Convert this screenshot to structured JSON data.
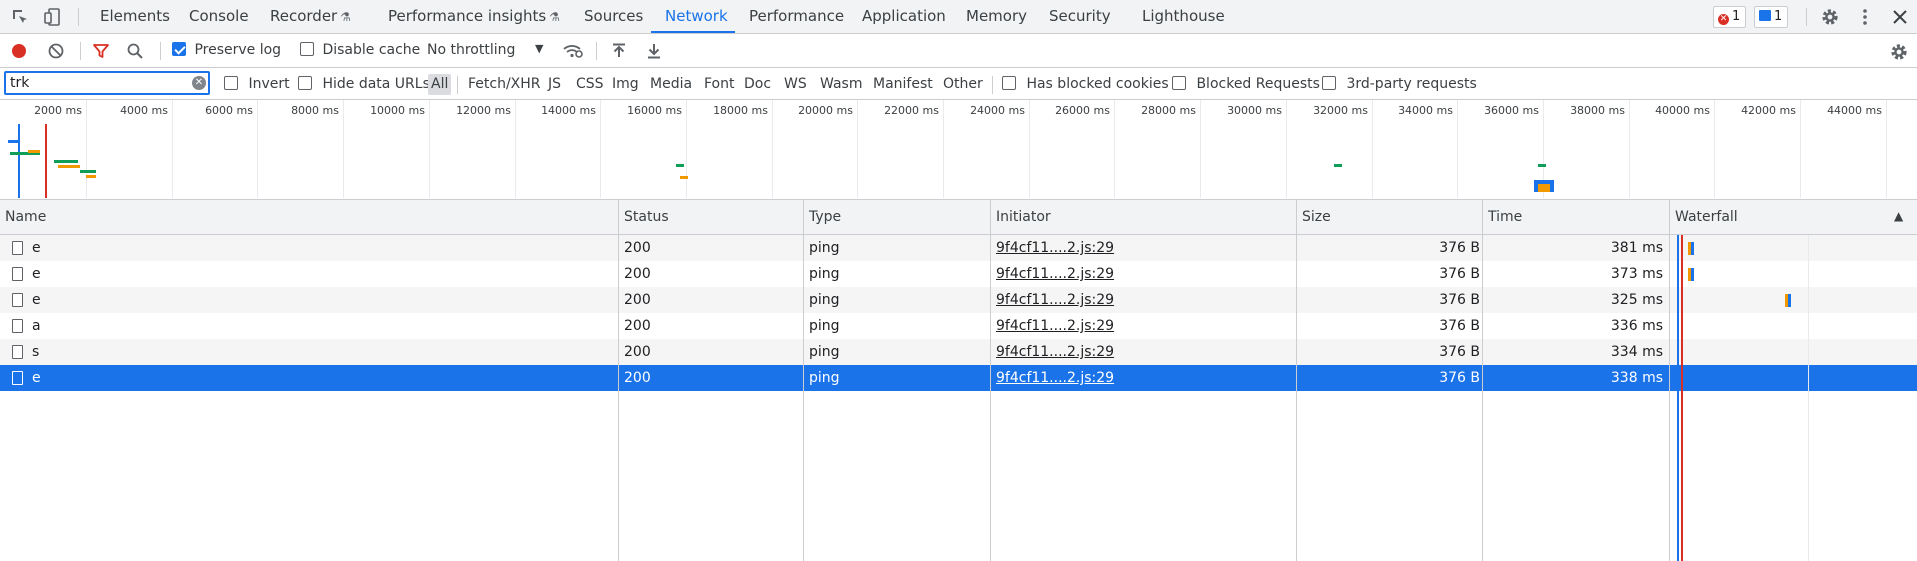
{
  "tabs": [
    {
      "label": "Elements",
      "flask": false,
      "active": false
    },
    {
      "label": "Console",
      "flask": false,
      "active": false
    },
    {
      "label": "Recorder",
      "flask": true,
      "active": false
    },
    {
      "label": "Performance insights",
      "flask": true,
      "active": false
    },
    {
      "label": "Sources",
      "flask": false,
      "active": false
    },
    {
      "label": "Network",
      "flask": false,
      "active": true
    },
    {
      "label": "Performance",
      "flask": false,
      "active": false
    },
    {
      "label": "Application",
      "flask": false,
      "active": false
    },
    {
      "label": "Memory",
      "flask": false,
      "active": false
    },
    {
      "label": "Security",
      "flask": false,
      "active": false
    },
    {
      "label": "Lighthouse",
      "flask": false,
      "active": false
    }
  ],
  "badges": {
    "errors": "1",
    "messages": "1"
  },
  "toolbar": {
    "preserve_log_label": "Preserve log",
    "preserve_log_checked": true,
    "disable_cache_label": "Disable cache",
    "disable_cache_checked": false,
    "throttling_value": "No throttling"
  },
  "filter": {
    "value": "trk",
    "invert_label": "Invert",
    "hide_data_urls_label": "Hide data URLs",
    "types": [
      "All",
      "Fetch/XHR",
      "JS",
      "CSS",
      "Img",
      "Media",
      "Font",
      "Doc",
      "WS",
      "Wasm",
      "Manifest",
      "Other"
    ],
    "active_type": "All",
    "blocked_cookies_label": "Has blocked cookies",
    "blocked_requests_label": "Blocked Requests",
    "third_party_label": "3rd-party requests"
  },
  "overview": {
    "ticks": [
      "2000 ms",
      "4000 ms",
      "6000 ms",
      "8000 ms",
      "10000 ms",
      "12000 ms",
      "14000 ms",
      "16000 ms",
      "18000 ms",
      "20000 ms",
      "22000 ms",
      "24000 ms",
      "26000 ms",
      "28000 ms",
      "30000 ms",
      "32000 ms",
      "34000 ms",
      "36000 ms",
      "38000 ms",
      "40000 ms",
      "42000 ms",
      "44000 ms"
    ]
  },
  "table": {
    "headers": {
      "name": "Name",
      "status": "Status",
      "type": "Type",
      "initiator": "Initiator",
      "size": "Size",
      "time": "Time",
      "waterfall": "Waterfall"
    },
    "rows": [
      {
        "name": "e",
        "status": "200",
        "type": "ping",
        "initiator": "9f4cf11....2.js:29",
        "size": "376 B",
        "time": "381 ms",
        "selected": false
      },
      {
        "name": "e",
        "status": "200",
        "type": "ping",
        "initiator": "9f4cf11....2.js:29",
        "size": "376 B",
        "time": "373 ms",
        "selected": false
      },
      {
        "name": "e",
        "status": "200",
        "type": "ping",
        "initiator": "9f4cf11....2.js:29",
        "size": "376 B",
        "time": "325 ms",
        "selected": false
      },
      {
        "name": "a",
        "status": "200",
        "type": "ping",
        "initiator": "9f4cf11....2.js:29",
        "size": "376 B",
        "time": "336 ms",
        "selected": false
      },
      {
        "name": "s",
        "status": "200",
        "type": "ping",
        "initiator": "9f4cf11....2.js:29",
        "size": "376 B",
        "time": "334 ms",
        "selected": false
      },
      {
        "name": "e",
        "status": "200",
        "type": "ping",
        "initiator": "9f4cf11....2.js:29",
        "size": "376 B",
        "time": "338 ms",
        "selected": true
      }
    ]
  },
  "colors": {
    "accent": "#1a73e8",
    "record": "#d93025",
    "green": "#0f9d58",
    "orange": "#f29900"
  }
}
